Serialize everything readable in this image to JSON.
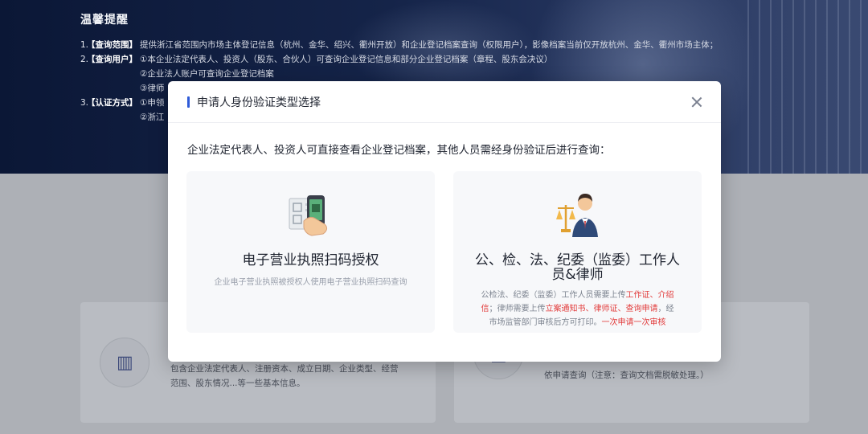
{
  "notice": {
    "title": "温馨提醒",
    "rows": [
      {
        "no": "1.",
        "tag": "【查询范围】",
        "text": "提供浙江省范围内市场主体登记信息（杭州、金华、绍兴、衢州开放）和企业登记档案查询（权限用户），影像档案当前仅开放杭州、金华、衢州市场主体；"
      },
      {
        "no": "2.",
        "tag": "【查询用户】",
        "text": "①本企业法定代表人、投资人（股东、合伙人）可查询企业登记信息和部分企业登记档案（章程、股东会决议）"
      },
      {
        "no": "",
        "tag": "",
        "text": "②企业法人账户可查询企业登记档案"
      },
      {
        "no": "",
        "tag": "",
        "text": "③律师"
      },
      {
        "no": "3.",
        "tag": "【认证方式】",
        "text": "①申领"
      },
      {
        "no": "",
        "tag": "",
        "text": "②浙江"
      }
    ]
  },
  "background": {
    "left_card_text_1": "包含企业法定代表人、注册资本、成立日期、企业类型、经营",
    "left_card_text_2": "范围、股东情况...等一些基本信息。",
    "right_card_text": "依申请查询（注意：查询文档需脱敏处理。）"
  },
  "modal": {
    "title": "申请人身份验证类型选择",
    "description": "企业法定代表人、投资人可直接查看企业登记档案，其他人员需经身份验证后进行查询：",
    "option_license": {
      "title": "电子营业执照扫码授权",
      "subtitle": "企业电子营业执照被授权人使用电子营业执照扫码查询"
    },
    "option_officer": {
      "title_line1": "公、检、法、纪委（监委）工作人",
      "title_line2": "员&律师",
      "line1_a": "公检法、纪委（监委）工作人员需要上传",
      "line1_b": "工作证、介绍",
      "line2_a": "信",
      "line2_b": "；律师需要上传",
      "line2_c": "立案通知书、律师证、查询申请",
      "line2_d": "，经",
      "line3_a": "市场监管部门审核后方可打印。",
      "line3_b": "一次申请一次审核"
    }
  },
  "colors": {
    "accent": "#2f5bd8",
    "warning_red": "#e23b3b",
    "hero_dark": "#0b1736"
  }
}
